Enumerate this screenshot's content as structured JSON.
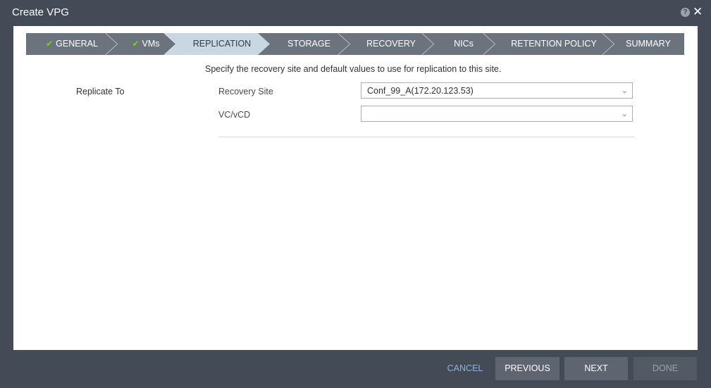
{
  "window": {
    "title": "Create VPG"
  },
  "wizard": {
    "steps": [
      {
        "label": "GENERAL",
        "done": true
      },
      {
        "label": "VMs",
        "done": true
      },
      {
        "label": "REPLICATION",
        "done": false
      },
      {
        "label": "STORAGE",
        "done": false
      },
      {
        "label": "RECOVERY",
        "done": false
      },
      {
        "label": "NICs",
        "done": false
      },
      {
        "label": "RETENTION POLICY",
        "done": false
      },
      {
        "label": "SUMMARY",
        "done": false
      }
    ],
    "active": "REPLICATION"
  },
  "main": {
    "description": "Specify the recovery site and default values to use for replication to this site.",
    "section_label": "Replicate To",
    "fields": [
      {
        "label": "Recovery Site",
        "value": "Conf_99_A(172.20.123.53)"
      },
      {
        "label": "VC/vCD",
        "value": ""
      }
    ]
  },
  "footer": {
    "cancel": "CANCEL",
    "previous": "PREVIOUS",
    "next": "NEXT",
    "done": "DONE"
  },
  "colors": {
    "chrome": "#434b56",
    "step_inactive": "#6b737d",
    "step_active": "#c9d7e2",
    "check": "#7ed321",
    "cancel_link": "#8fb3d6"
  }
}
